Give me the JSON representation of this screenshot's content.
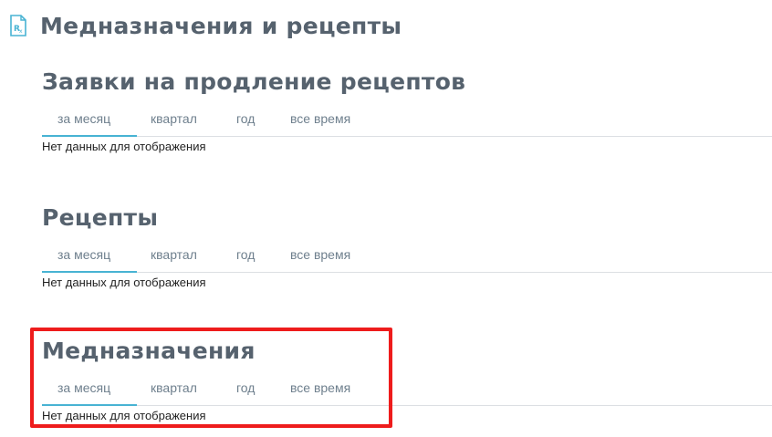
{
  "header": {
    "icon": "prescription-document-icon",
    "title": "Медназначения и рецепты"
  },
  "sections": [
    {
      "title": "Заявки на продление рецептов",
      "tabs": [
        "за месяц",
        "квартал",
        "год",
        "все время"
      ],
      "active_tab": "за месяц",
      "empty_text": "Нет данных для отображения"
    },
    {
      "title": "Рецепты",
      "tabs": [
        "за месяц",
        "квартал",
        "год",
        "все время"
      ],
      "active_tab": "за месяц",
      "empty_text": "Нет данных для отображения"
    },
    {
      "title": "Медназначения",
      "tabs": [
        "за месяц",
        "квартал",
        "год",
        "все время"
      ],
      "active_tab": "за месяц",
      "empty_text": "Нет данных для отображения"
    }
  ],
  "colors": {
    "title": "#56626e",
    "tab_text": "#6e7f8d",
    "active_underline": "#48b3d3",
    "highlight": "#ee1c1c"
  }
}
